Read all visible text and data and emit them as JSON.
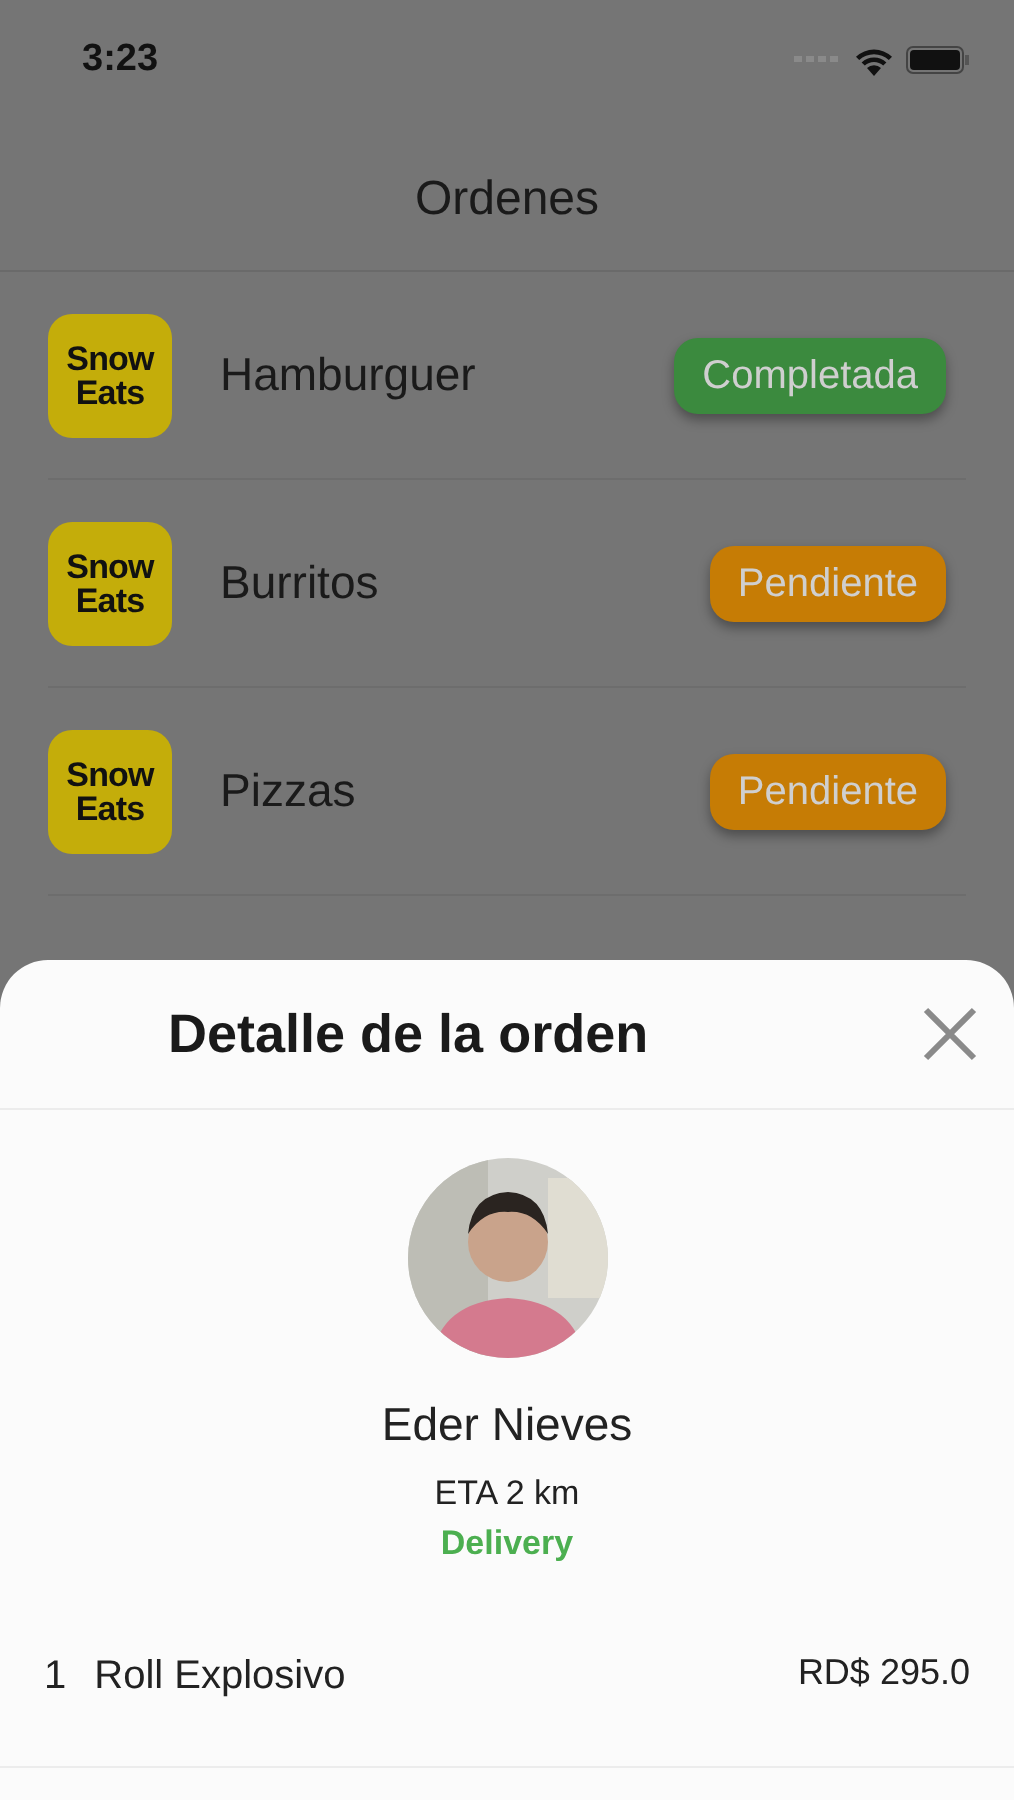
{
  "status_bar": {
    "time": "3:23"
  },
  "header": {
    "title": "Ordenes"
  },
  "orders": [
    {
      "logo_text": [
        "Snow",
        "Eats"
      ],
      "name": "Hamburguer",
      "status": "Completada",
      "color": "#3b8a3e"
    },
    {
      "logo_text": [
        "Snow",
        "Eats"
      ],
      "name": "Burritos",
      "status": "Pendiente",
      "color": "#c67c05"
    },
    {
      "logo_text": [
        "Snow",
        "Eats"
      ],
      "name": "Pizzas",
      "status": "Pendiente",
      "color": "#c67c05"
    }
  ],
  "sheet": {
    "title": "Detalle de la orden",
    "courier": {
      "name": "Eder Nieves",
      "eta": "ETA 2 km",
      "mode": "Delivery"
    },
    "items": [
      {
        "quantity": "1",
        "name": "Roll Explosivo",
        "price": "RD$ 295.0"
      }
    ]
  }
}
